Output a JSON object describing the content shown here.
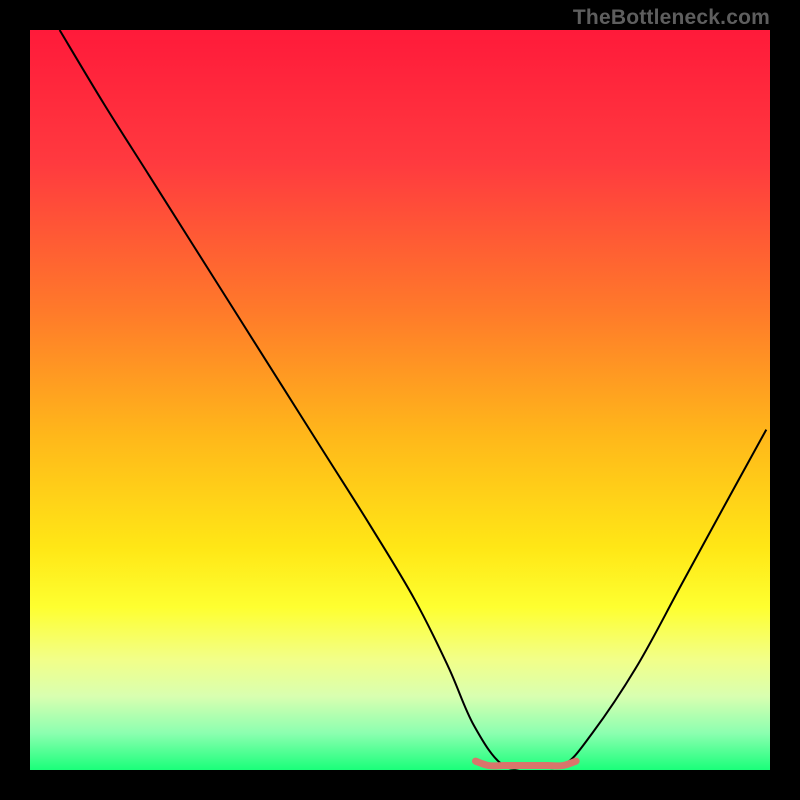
{
  "watermark": "TheBottleneck.com",
  "chart_data": {
    "type": "line",
    "title": "",
    "xlabel": "",
    "ylabel": "",
    "xlim": [
      0,
      100
    ],
    "ylim": [
      0,
      100
    ],
    "gradient_stops": [
      {
        "offset": 0,
        "color": "#ff1a3a"
      },
      {
        "offset": 18,
        "color": "#ff3a3f"
      },
      {
        "offset": 38,
        "color": "#ff7a2a"
      },
      {
        "offset": 55,
        "color": "#ffb81a"
      },
      {
        "offset": 70,
        "color": "#ffe716"
      },
      {
        "offset": 78,
        "color": "#feff30"
      },
      {
        "offset": 85,
        "color": "#f2ff88"
      },
      {
        "offset": 90,
        "color": "#d9ffb0"
      },
      {
        "offset": 95,
        "color": "#8cffb0"
      },
      {
        "offset": 100,
        "color": "#1aff7a"
      }
    ],
    "series": [
      {
        "name": "curve",
        "color": "#000000",
        "stroke_width": 2,
        "x": [
          4,
          10,
          16,
          22,
          28,
          34,
          40,
          46,
          52,
          56.5,
          60,
          64,
          68,
          72,
          76,
          82,
          88,
          94,
          99.5
        ],
        "values": [
          100,
          90,
          80.5,
          71,
          61.5,
          52,
          42.5,
          33,
          23,
          14,
          6,
          0.6,
          0.6,
          0.6,
          5,
          14,
          25,
          36,
          46
        ]
      },
      {
        "name": "flat-marker",
        "color": "#d9756b",
        "stroke_width": 7,
        "linecap": "round",
        "x": [
          60.2,
          62,
          64,
          66,
          68,
          70,
          72,
          73.8
        ],
        "values": [
          1.2,
          0.6,
          0.6,
          0.6,
          0.6,
          0.6,
          0.6,
          1.2
        ]
      }
    ]
  }
}
